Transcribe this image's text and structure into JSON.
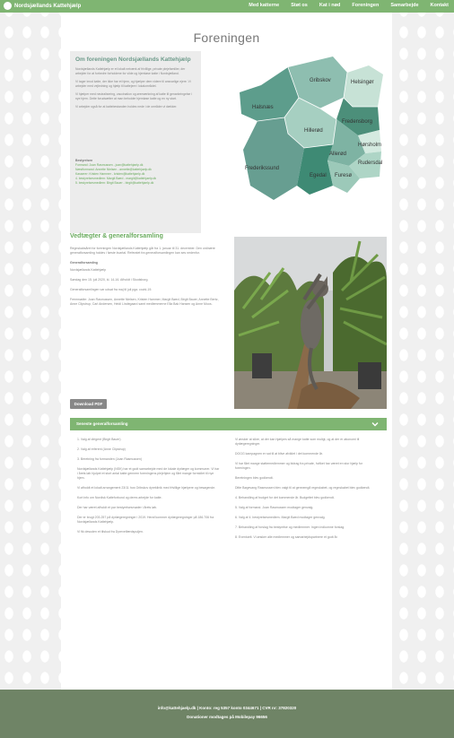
{
  "nav": {
    "brand": "Nordsjællands Kattehjælp",
    "menu": [
      "Med katterne",
      "Støt os",
      "Kat i nød",
      "Foreningen",
      "Samarbejde",
      "Kontakt"
    ]
  },
  "page_title": "Foreningen",
  "about": {
    "heading": "Om foreningen Nordsjællands Kattehjælp",
    "paragraphs": [
      "Nordsjællands Kattehjælp er et lokalt netværk af frivillige, private plejefamilier, der arbejder for at forbedre forholdene for vilde og hjemløse katte i Nordsjælland.",
      "Vi tager imod katte, der ikke har et hjem, og hjælper dem videre til ansvarlige ejere. Vi arbejder med vejledning og hjælp til kattejere i lokalområdet.",
      "Vi hjælper med neutralisering, vaccination og øremærkning af katte til genanbringelse i nye hjem. Dette forudsætter at man beholder hjemløse katte og en ny start.",
      "Vi arbejder også for at kattebestanden holdes nede i de områder vi dækker."
    ],
    "board_title": "Bestyrelsen",
    "board": [
      "Formand: Joan Rasmussen - joan@kattehjaelp.dk",
      "Næstformand: Annette Nielsen - annette@kattehjaelp.dk",
      "Kasserer: Kristen Hammer - kristen@kattehjaelp.dk",
      "4. bestyrelsesmedlem: Margit Bøed - margit@kattehjaelp.dk",
      "5. bestyrelsesmedlem: Birgit Bauer - birgit@kattehjaelp.dk"
    ]
  },
  "map": {
    "regions": [
      "Gribskov",
      "Helsingør",
      "Halsnæs",
      "Fredensborg",
      "Hillerød",
      "Hørsholm",
      "Allerød",
      "Rudersdal",
      "Frederikssund",
      "Egedal",
      "Furesø"
    ]
  },
  "statutes": {
    "heading": "Vedtægter & generalforsamling",
    "paragraphs": [
      "Regnskabsåret for foreningen Nordsjællands Kattehjælp går fra 1. januar til 31. december. Den ordinære generalforsamling holdes i første kvartal. Referatet fra generalforsamlingen kan ses nedenfor.",
      "Generalforsamling",
      "Nordsjællands Kattehjælp",
      "Søndag den 15. juli 2020, kl. 14-16. Afholdt i Skodsborg.",
      "Generalforsamlingen var udsat fra maj til juli pga. covid-19.",
      "Fremmødte: Joan Rasmussen, Annette Nielsen, Kristen Hammer, Margit Bøed, Birgit Bauer, Annette Bertz, Anne Clipstrup, Carl Andersen, Heidi Lindegaard samt medlemmerne Ella Bak Hansen og Anne Moos."
    ],
    "download": "Download PDF"
  },
  "accordion": {
    "title": "Seneste generalforsamling",
    "left": [
      "1. Valg af dirigent (Birgit Bauer)",
      "2. Valg af referent (Anne Clipstrup)",
      "3. Beretning fra formanden (Joan Rasmussen)",
      "Nordsjællands Kattehjælp (NSK) har et godt samarbejde med de lokale dyrlæger og kommuner. Vi har i årets løb hjulpet et stort antal katte gennem foreningens plejehjem og fået mange formidlet til nye hjem.",
      "Vi afholdt et lokalt arrangement 23/11 hos Gribskov dyreklinik med frivillige hjælpere og besøgende.",
      "Kort info om Nordisk Katteforbund og deres arbejde for katte.",
      "Der har været afholdt et par bestyrelsesmøder i årets løb.",
      "Der er brugt 203.257 på dyrlægeregninger i 2019. Heraf kommer dyrlægeregninger på 186.706 fra Nordsjællands Kattehjælp.",
      "Vi fik desuden et tilskud fra Dyrevelfærdspuljen."
    ],
    "right": [
      "Vi ønsker at sikre, at der kan hjælpes så mange katte som muligt, og at der er økonomi til dyrlægeregninger.",
      "DOGG kampagnen er sat til at blive afviklet i det kommende år.",
      "Vi har fået mange støttemedlemmer og bidrag fra private, hvilket har været en stor hjælp for foreningen.",
      "Beretningen blev godkendt.",
      "Ditte Bøgevang Rasmussen blev valgt til at gennemgå regnskabet, og regnskabet blev godkendt.",
      "4. Behandling af budget for det kommende år. Budgettet blev godkendt.",
      "5. Valg af formand. Joan Rasmussen modtager genvalg.",
      "6. Valg af 4. bestyrelsesmedlem. Margit Bøed modtager genvalg.",
      "7. Behandling af forslag fra bestyrelse og medlemmer. Ingen indkomne forslag.",
      "8. Eventuelt. Vi ønsker alle medlemmer og samarbejdspartnere et godt år."
    ]
  },
  "footer": {
    "line1": "info@kattehjaelp.dk  |  Konto: reg 5357 konto 0344671  |  CVR nr: 37820320",
    "line2": "Donationer modtages på Mobilepay 96656"
  },
  "colors": {
    "green": "#7fb572",
    "footer": "#6f8466",
    "heading_teal": "#6d9a8a"
  }
}
